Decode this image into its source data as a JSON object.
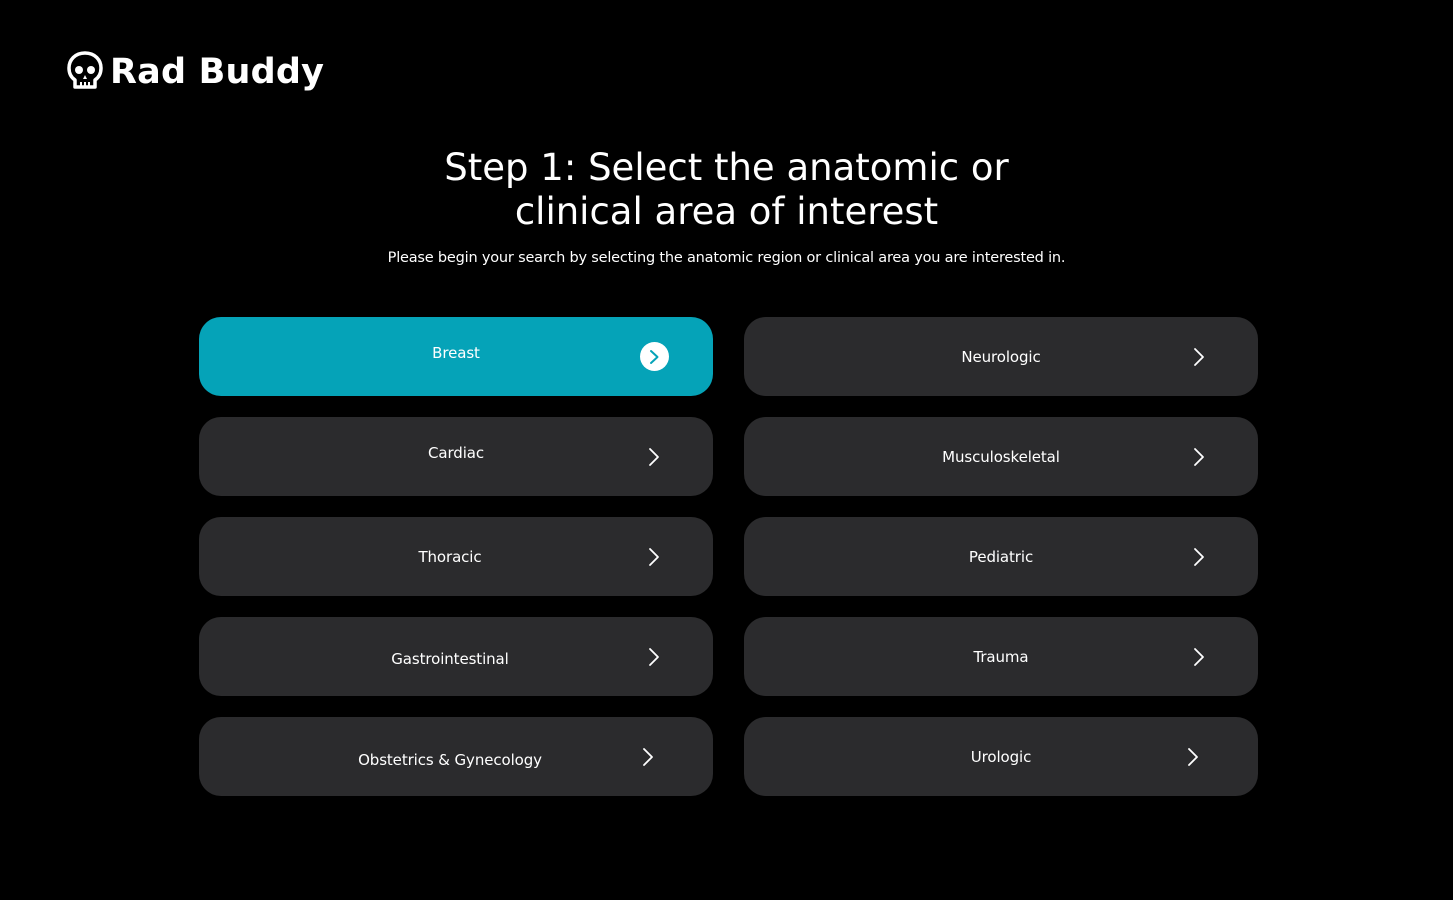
{
  "app": {
    "name": "Rad Buddy",
    "logo_icon": "skull-icon"
  },
  "header": {
    "title": "Step 1: Select the anatomic or clinical area of interest",
    "subtitle": "Please begin your search by selecting the anatomic region or clinical area you are interested in."
  },
  "areas": {
    "selected": "Breast",
    "items": [
      {
        "label": "Breast",
        "icon": "chevron-right-icon"
      },
      {
        "label": "Neurologic",
        "icon": "chevron-right-icon"
      },
      {
        "label": "Cardiac",
        "icon": "chevron-right-icon"
      },
      {
        "label": "Musculoskeletal",
        "icon": "chevron-right-icon"
      },
      {
        "label": "Thoracic",
        "icon": "chevron-right-icon"
      },
      {
        "label": "Pediatric",
        "icon": "chevron-right-icon"
      },
      {
        "label": "Gastrointestinal",
        "icon": "chevron-right-icon"
      },
      {
        "label": "Trauma",
        "icon": "chevron-right-icon"
      },
      {
        "label": "Obstetrics & Gynecology",
        "icon": "chevron-right-icon"
      },
      {
        "label": "Urologic",
        "icon": "chevron-right-icon"
      }
    ]
  },
  "colors": {
    "background": "#000000",
    "card": "#2b2b2d",
    "accent": "#05a3b8",
    "text": "#ffffff"
  }
}
